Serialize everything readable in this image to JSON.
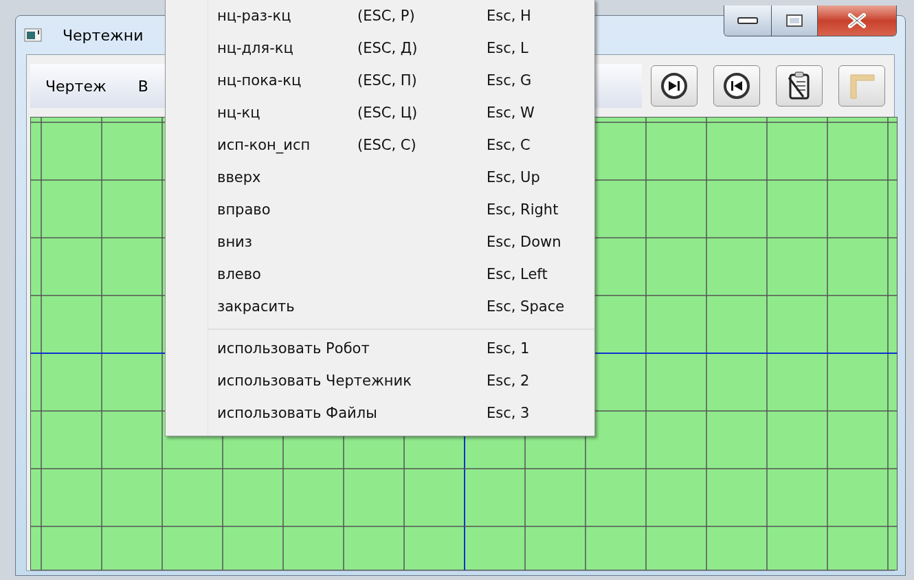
{
  "window": {
    "title": "Чертежни"
  },
  "menu_bar": [
    {
      "label": "Чертеж"
    },
    {
      "label": "В"
    }
  ],
  "popup_menu": {
    "sections": [
      {
        "items": [
          {
            "label": "нц-раз-кц",
            "code": "(ESC, Р)",
            "shortcut": "Esc, H"
          },
          {
            "label": "нц-для-кц",
            "code": "(ESC, Д)",
            "shortcut": "Esc, L"
          },
          {
            "label": "нц-пока-кц",
            "code": "(ESC, П)",
            "shortcut": "Esc, G"
          },
          {
            "label": "нц-кц",
            "code": "(ESC, Ц)",
            "shortcut": "Esc, W"
          },
          {
            "label": "исп-кон_исп",
            "code": "(ESC, С)",
            "shortcut": "Esc, C"
          },
          {
            "label": "вверх",
            "shortcut": "Esc, Up"
          },
          {
            "label": "вправо",
            "shortcut": "Esc, Right"
          },
          {
            "label": "вниз",
            "shortcut": "Esc, Down"
          },
          {
            "label": "влево",
            "shortcut": "Esc, Left"
          },
          {
            "label": "закрасить",
            "shortcut": "Esc, Space"
          }
        ]
      },
      {
        "items": [
          {
            "label": "использовать Робот",
            "shortcut": "Esc, 1"
          },
          {
            "label": "использовать Чертежник",
            "shortcut": "Esc, 2"
          },
          {
            "label": "использовать Файлы",
            "shortcut": "Esc, 3"
          }
        ]
      }
    ]
  }
}
